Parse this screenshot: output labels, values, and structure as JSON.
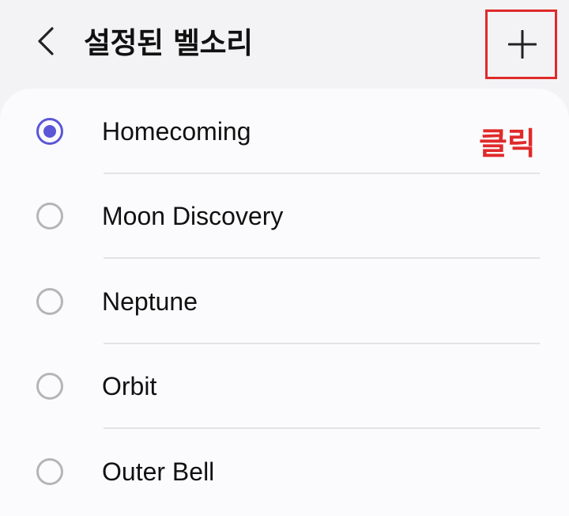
{
  "header": {
    "title": "설정된 벨소리",
    "back_icon": "chevron-left-icon",
    "add_icon": "plus-icon"
  },
  "annotation": {
    "text": "클릭",
    "color": "#e02a2a"
  },
  "colors": {
    "accent": "#5b57d6",
    "highlight": "#e02a2a"
  },
  "ringtones": {
    "selected_index": 0,
    "items": [
      {
        "label": "Homecoming",
        "selected": true
      },
      {
        "label": "Moon Discovery",
        "selected": false
      },
      {
        "label": "Neptune",
        "selected": false
      },
      {
        "label": "Orbit",
        "selected": false
      },
      {
        "label": "Outer Bell",
        "selected": false
      }
    ]
  }
}
